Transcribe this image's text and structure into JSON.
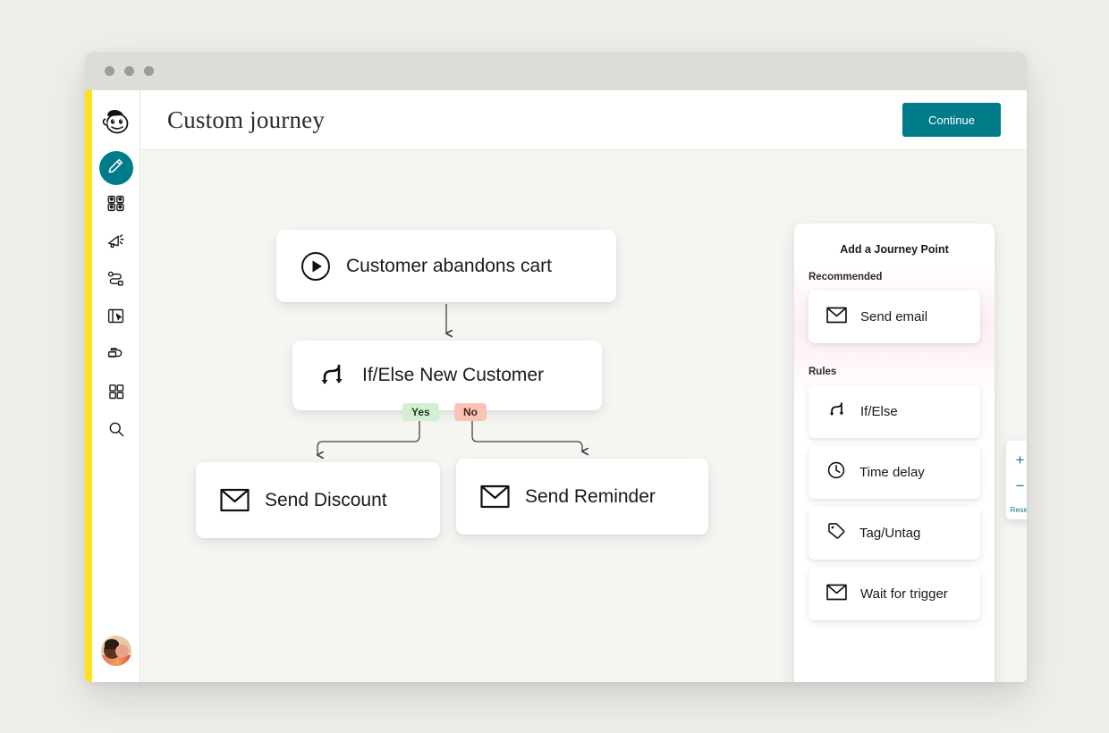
{
  "window": {
    "traffic_lights": [
      "close",
      "minimize",
      "maximize"
    ]
  },
  "brand": {
    "logo": "mailchimp-freddie-logo"
  },
  "sidebar": {
    "items": [
      {
        "label": "Create",
        "icon": "pencil-icon",
        "active": true
      },
      {
        "label": "Audience",
        "icon": "audience-icon",
        "active": false
      },
      {
        "label": "Campaigns",
        "icon": "megaphone-icon",
        "active": false
      },
      {
        "label": "Automations",
        "icon": "journey-path-icon",
        "active": false
      },
      {
        "label": "Website",
        "icon": "website-cursor-icon",
        "active": false
      },
      {
        "label": "Content",
        "icon": "content-stack-icon",
        "active": false
      },
      {
        "label": "Integrations",
        "icon": "grid-apps-icon",
        "active": false
      },
      {
        "label": "Search",
        "icon": "search-icon",
        "active": false
      }
    ],
    "avatar": "user-avatar-photo"
  },
  "header": {
    "title": "Custom journey",
    "continue_label": "Continue"
  },
  "canvas": {
    "nodes": [
      {
        "id": "trigger",
        "label": "Customer abandons cart",
        "icon": "play-circle-icon"
      },
      {
        "id": "ifelse",
        "label": "If/Else New Customer",
        "icon": "branch-icon"
      },
      {
        "id": "discount",
        "label": "Send Discount",
        "icon": "envelope-icon"
      },
      {
        "id": "reminder",
        "label": "Send Reminder",
        "icon": "envelope-icon"
      }
    ],
    "branches": [
      {
        "id": "yes",
        "label": "Yes",
        "color": "#d4eed1"
      },
      {
        "id": "no",
        "label": "No",
        "color": "#fac4b4"
      }
    ]
  },
  "journey_panel": {
    "title": "Add a Journey Point",
    "sections": [
      {
        "label": "Recommended",
        "items": [
          {
            "label": "Send email",
            "icon": "envelope-icon"
          }
        ]
      },
      {
        "label": "Rules",
        "items": [
          {
            "label": "If/Else",
            "icon": "branch-icon"
          },
          {
            "label": "Time delay",
            "icon": "clock-icon"
          },
          {
            "label": "Tag/Untag",
            "icon": "tag-icon"
          },
          {
            "label": "Wait for trigger",
            "icon": "envelope-icon"
          }
        ]
      }
    ]
  },
  "zoom_controls": {
    "zoom_in": "+",
    "zoom_out": "−",
    "reset": "Reset"
  },
  "colors": {
    "brand_yellow": "#ffe01b",
    "accent_teal": "#007c89",
    "page_bg": "#efeeeb",
    "canvas_bg": "#f5f5f2"
  }
}
